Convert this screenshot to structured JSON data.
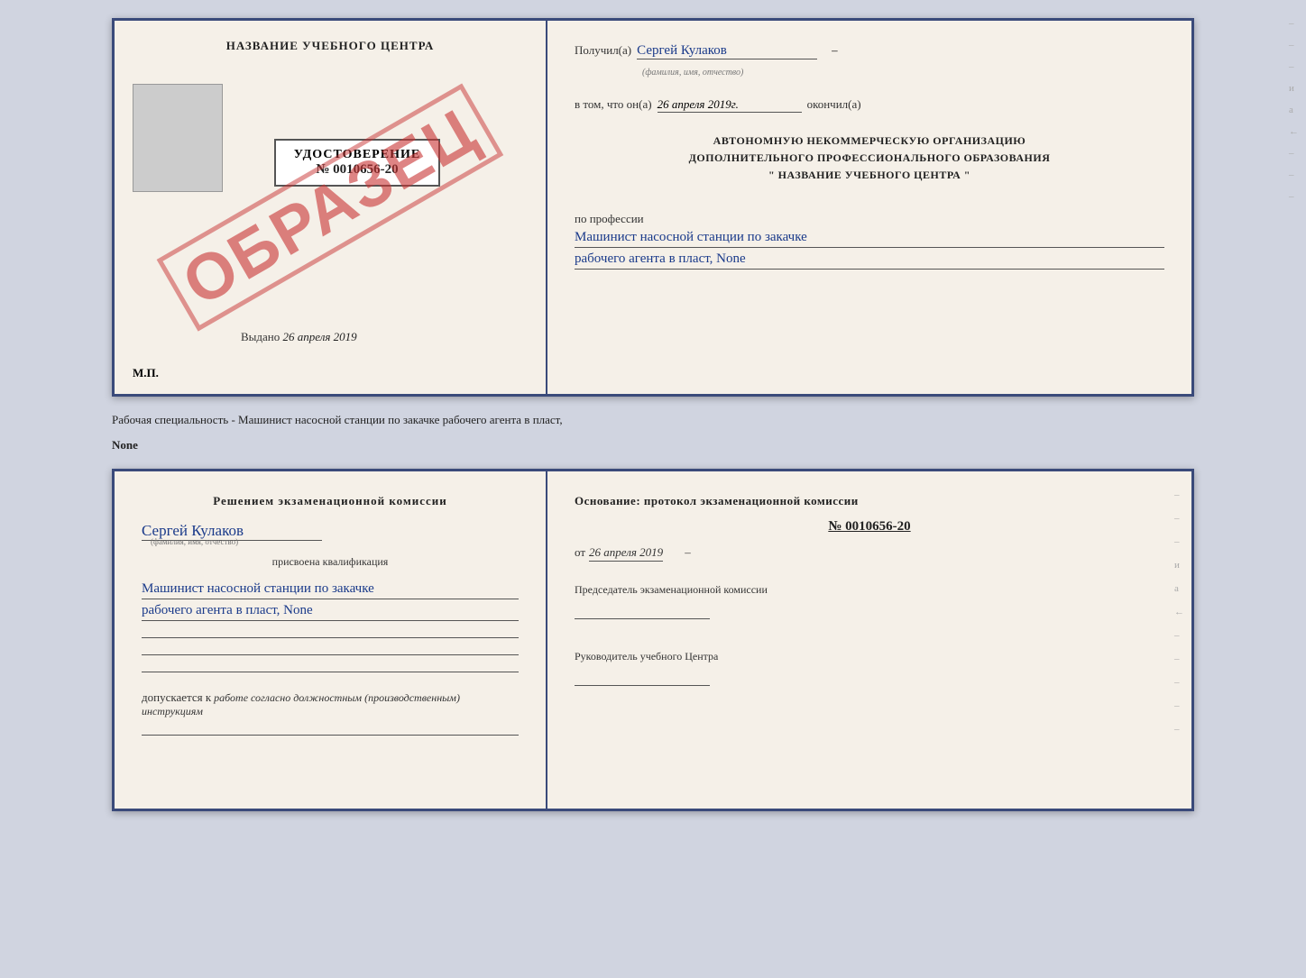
{
  "topCert": {
    "left": {
      "title": "НАЗВАНИЕ УЧЕБНОГО ЦЕНТРА",
      "badge_title": "УДОСТОВЕРЕНИЕ",
      "badge_number": "№ 0010656-20",
      "issued_label": "Выдано",
      "issued_date": "26 апреля 2019",
      "mp_label": "М.П.",
      "stamp_text": "ОБРАЗЕЦ"
    },
    "right": {
      "received_label": "Получил(а)",
      "received_name": "Сергей Кулаков",
      "name_hint": "(фамилия, имя, отчество)",
      "date_label": "в том, что он(а)",
      "date_value": "26 апреля 2019г.",
      "finished_label": "окончил(а)",
      "org_line1": "АВТОНОМНУЮ НЕКОММЕРЧЕСКУЮ ОРГАНИЗАЦИЮ",
      "org_line2": "ДОПОЛНИТЕЛЬНОГО ПРОФЕССИОНАЛЬНОГО ОБРАЗОВАНИЯ",
      "org_line3": "\"   НАЗВАНИЕ УЧЕБНОГО ЦЕНТРА   \"",
      "profession_label": "по профессии",
      "profession_line1": "Машинист насосной станции по закачке",
      "profession_line2": "рабочего агента в пласт, None"
    }
  },
  "description": {
    "text": "Рабочая специальность - Машинист насосной станции по закачке рабочего агента в пласт,",
    "text2": "None"
  },
  "bottomCert": {
    "left": {
      "decision_label": "Решением экзаменационной комиссии",
      "person_name": "Сергей Кулаков",
      "name_hint": "(фамилия, имя, отчество)",
      "assigned_label": "присвоена квалификация",
      "qualification_line1": "Машинист насосной станции по закачке",
      "qualification_line2": "рабочего агента в пласт, None",
      "allow_label": "допускается к",
      "allow_text": "работе согласно должностным (производственным) инструкциям"
    },
    "right": {
      "basis_label": "Основание: протокол экзаменационной комиссии",
      "protocol_number": "№ 0010656-20",
      "date_prefix": "от",
      "date_value": "26 апреля 2019",
      "chairman_label": "Председатель экзаменационной комиссии",
      "director_label": "Руководитель учебного Центра"
    }
  },
  "margins": {
    "right_labels": [
      "-",
      "-",
      "-",
      "и",
      "а",
      "←",
      "-",
      "-",
      "-",
      "-",
      "-",
      "-"
    ]
  }
}
